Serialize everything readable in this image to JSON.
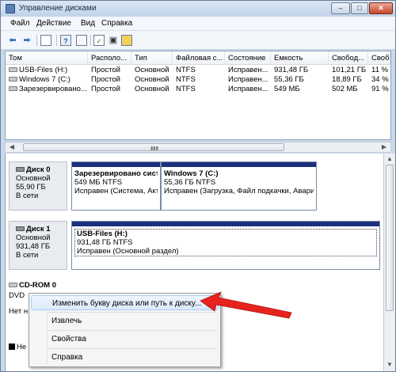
{
  "window": {
    "title": "Управление дисками",
    "buttons": [
      "–",
      "□",
      "✕"
    ]
  },
  "menu": [
    "Файл",
    "Действие",
    "Вид",
    "Справка"
  ],
  "toolbar": {
    "icons": [
      "back-icon",
      "forward-icon",
      "console-tree-icon",
      "help-icon",
      "properties-icon",
      "refresh-icon",
      "settings-icon"
    ]
  },
  "table": {
    "columns": [
      "Том",
      "Располо...",
      "Тип",
      "Файловая с...",
      "Состояние",
      "Емкость",
      "Свобод...",
      "Своб"
    ],
    "rows": [
      [
        "USB-Files (H:)",
        "Простой",
        "Основной",
        "NTFS",
        "Исправен...",
        "931,48 ГБ",
        "101,21 ГБ",
        "11 %"
      ],
      [
        "Windows 7 (C:)",
        "Простой",
        "Основной",
        "NTFS",
        "Исправен...",
        "55,36 ГБ",
        "18,89 ГБ",
        "34 %"
      ],
      [
        "Зарезервировано...",
        "Простой",
        "Основной",
        "NTFS",
        "Исправен...",
        "549 МБ",
        "502 МБ",
        "91 %"
      ]
    ]
  },
  "disks": {
    "disk0": {
      "name": "Диск 0",
      "type": "Основной",
      "size": "55,90 ГБ",
      "status": "В сети",
      "partitions": [
        {
          "name": "Зарезервировано систе",
          "size": "549 МБ NTFS",
          "status": "Исправен (Система, Акт"
        },
        {
          "name": "Windows 7  (C:)",
          "size": "55,36 ГБ NTFS",
          "status": "Исправен (Загрузка, Файл подкачки, Аварий"
        }
      ]
    },
    "disk1": {
      "name": "Диск 1",
      "type": "Основной",
      "size": "931,48 ГБ",
      "status": "В сети",
      "partitions": [
        {
          "name": "USB-Files  (H:)",
          "size": "931,48 ГБ NTFS",
          "status": "Исправен (Основной раздел)"
        }
      ]
    },
    "cdrom": {
      "name": "CD-ROM 0",
      "type": "DVD",
      "status": "Нет н"
    }
  },
  "context_menu": {
    "items": [
      "Изменить букву диска или путь к диску...",
      "Извлечь",
      "Свойства",
      "Справка"
    ],
    "highlighted": 0
  },
  "legend": {
    "label": "Не"
  },
  "colors": {
    "partition_bar": "#1c2f7d",
    "arrow": "#e8231e"
  }
}
